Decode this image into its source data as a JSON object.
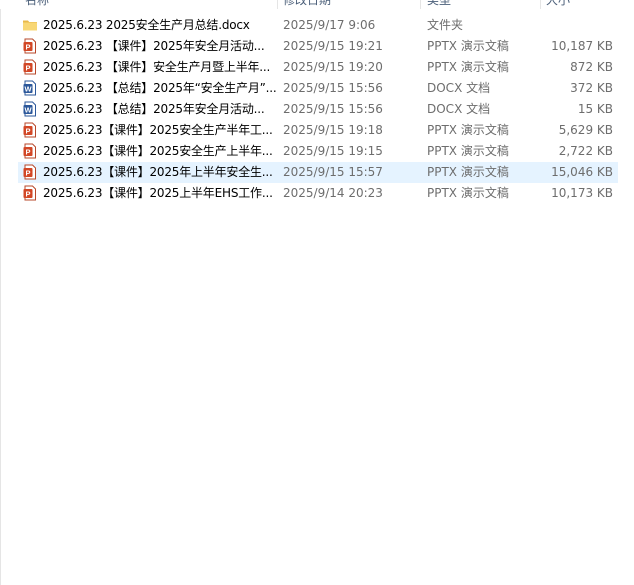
{
  "columns": {
    "name": "名称",
    "date": "修改日期",
    "type": "类型",
    "size": "大小"
  },
  "files": [
    {
      "icon": "folder-icon",
      "name": "2025.6.23 2025安全生产月总结.docx",
      "date": "2025/9/17 9:06",
      "type": "文件夹",
      "size": ""
    },
    {
      "icon": "pptx-file-icon",
      "name": "2025.6.23 【课件】2025年安全月活动...",
      "date": "2025/9/15 19:21",
      "type": "PPTX 演示文稿",
      "size": "10,187 KB"
    },
    {
      "icon": "pptx-file-icon",
      "name": "2025.6.23 【课件】安全生产月暨上半年...",
      "date": "2025/9/15 19:20",
      "type": "PPTX 演示文稿",
      "size": "872 KB"
    },
    {
      "icon": "docx-file-icon",
      "name": "2025.6.23 【总结】2025年“安全生产月”...",
      "date": "2025/9/15 15:56",
      "type": "DOCX 文档",
      "size": "372 KB"
    },
    {
      "icon": "docx-file-icon",
      "name": "2025.6.23 【总结】2025年安全月活动...",
      "date": "2025/9/15 15:56",
      "type": "DOCX 文档",
      "size": "15 KB"
    },
    {
      "icon": "pptx-file-icon",
      "name": "2025.6.23【课件】2025安全生产半年工...",
      "date": "2025/9/15 19:18",
      "type": "PPTX 演示文稿",
      "size": "5,629 KB"
    },
    {
      "icon": "pptx-file-icon",
      "name": "2025.6.23【课件】2025安全生产上半年...",
      "date": "2025/9/15 19:15",
      "type": "PPTX 演示文稿",
      "size": "2,722 KB"
    },
    {
      "icon": "pptx-file-icon",
      "name": "2025.6.23【课件】2025年上半年安全生...",
      "date": "2025/9/15 15:57",
      "type": "PPTX 演示文稿",
      "size": "15,046 KB",
      "selected": true
    },
    {
      "icon": "pptx-file-icon",
      "name": "2025.6.23【课件】2025上半年EHS工作...",
      "date": "2025/9/14 20:23",
      "type": "PPTX 演示文稿",
      "size": "10,173 KB"
    }
  ],
  "colors": {
    "selection": "#e5f3ff",
    "pptx_icon": "#d24726",
    "docx_icon": "#2b579a",
    "folder_icon": "#f8d775",
    "secondary_text": "#6d6d6d"
  }
}
